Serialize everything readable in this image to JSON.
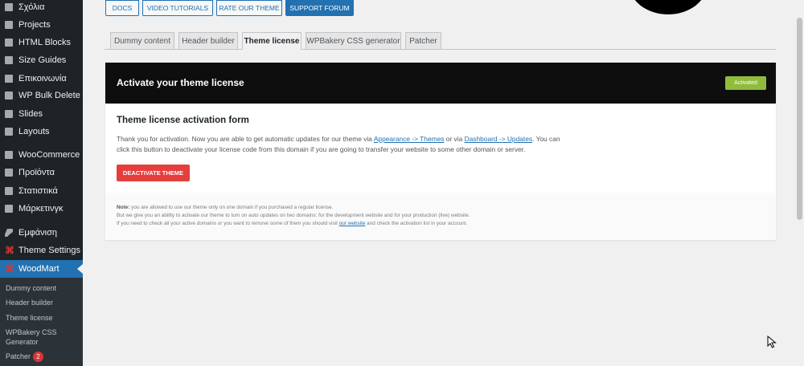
{
  "sidebar": {
    "items": [
      {
        "label": "Σχόλια",
        "icon": "comments-icon"
      },
      {
        "label": "Projects",
        "icon": "projects-icon"
      },
      {
        "label": "HTML Blocks",
        "icon": "blocks-icon"
      },
      {
        "label": "Size Guides",
        "icon": "size-guide-icon"
      },
      {
        "label": "Επικοινωνία",
        "icon": "mail-icon"
      },
      {
        "label": "WP Bulk Delete",
        "icon": "delete-icon"
      },
      {
        "label": "Slides",
        "icon": "slides-icon"
      },
      {
        "label": "Layouts",
        "icon": "layouts-icon"
      },
      {
        "label": "WooCommerce",
        "icon": "woocommerce-icon"
      },
      {
        "label": "Προϊόντα",
        "icon": "products-icon"
      },
      {
        "label": "Στατιστικά",
        "icon": "stats-icon"
      },
      {
        "label": "Μάρκετινγκ",
        "icon": "megaphone-icon"
      },
      {
        "label": "Εμφάνιση",
        "icon": "paintbrush-icon"
      },
      {
        "label": "Theme Settings",
        "icon": "woodmart-icon"
      },
      {
        "label": "WoodMart",
        "icon": "woodmart-icon"
      }
    ],
    "submenu": [
      {
        "label": "Dummy content"
      },
      {
        "label": "Header builder"
      },
      {
        "label": "Theme license"
      },
      {
        "label": "WPBakery CSS Generator"
      },
      {
        "label": "Patcher",
        "badge": "2"
      }
    ]
  },
  "top_buttons": [
    "DOCS",
    "VIDEO TUTORIALS",
    "RATE OUR THEME",
    "SUPPORT FORUM"
  ],
  "tabs": [
    "Dummy content",
    "Header builder",
    "Theme license",
    "WPBakery CSS generator",
    "Patcher"
  ],
  "active_tab": "Theme license",
  "panel": {
    "title": "Activate your theme license",
    "status": "Activated",
    "form_title": "Theme license activation form",
    "desc_1": "Thank you for activation. Now you are able to get automatic updates for our theme via ",
    "link_appearance": "Appearance -> Themes",
    "desc_2": " or via ",
    "link_dashboard": "Dashboard -> Updates",
    "desc_3": ". You can click this button to deactivate your license code from this domain if you are going to transfer your website to some other domain or server.",
    "deactivate_label": "DEACTIVATE THEME",
    "note_label": "Note:",
    "note_1": " you are allowed to use our theme only on one domain if you purchased a regular license.",
    "note_2": "But we give you an ability to activate our theme to turn on auto updates on two domains: for the development website and for your production (live) website.",
    "note_3a": "If you need to check all your active domains or you want to remove some of them you should visit ",
    "note_link": "our website",
    "note_3b": " and check the activation list in your account."
  },
  "colors": {
    "sidebar_bg": "#1d2327",
    "active_menu": "#2271b1",
    "header_bg": "#0e0e0e",
    "activated_badge": "#8fbc3b",
    "deactivate_button": "#e53e3e"
  }
}
